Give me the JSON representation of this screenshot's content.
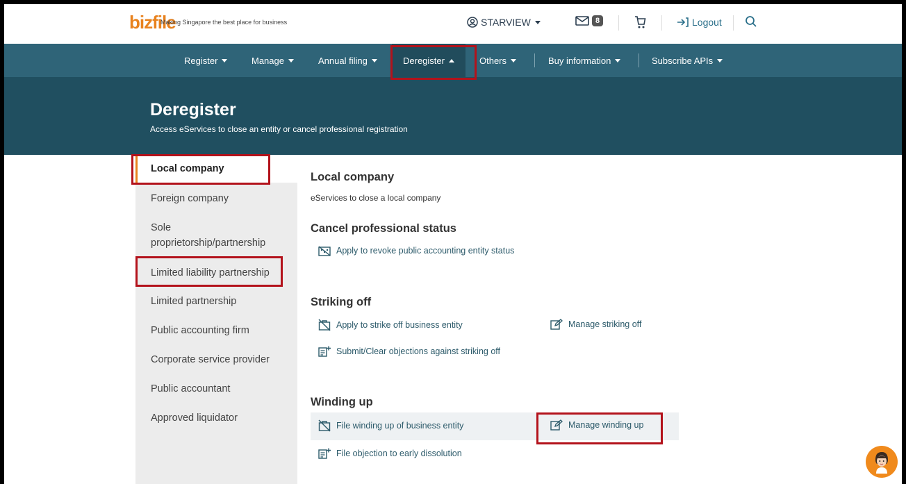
{
  "header": {
    "logo_text": "bizfile",
    "tagline": "Making Singapore the best place for business",
    "user": "STARVIEW",
    "mail_count": "8",
    "logout": "Logout"
  },
  "nav": [
    {
      "label": "Register"
    },
    {
      "label": "Manage"
    },
    {
      "label": "Annual filing"
    },
    {
      "label": "Deregister"
    },
    {
      "label": "Others"
    },
    {
      "label": "Buy information"
    },
    {
      "label": "Subscribe APIs"
    }
  ],
  "banner": {
    "title": "Deregister",
    "subtitle": "Access eServices to close an entity or cancel professional registration"
  },
  "sidebar": {
    "items": [
      {
        "label": "Local company"
      },
      {
        "label": "Foreign company"
      },
      {
        "label": "Sole"
      },
      {
        "label": "proprietorship/partnership"
      },
      {
        "label": "Limited liability partnership"
      },
      {
        "label": "Limited partnership"
      },
      {
        "label": "Public accounting firm"
      },
      {
        "label": "Corporate service provider"
      },
      {
        "label": "Public accountant"
      },
      {
        "label": "Approved liquidator"
      }
    ]
  },
  "main": {
    "title": "Local company",
    "description": "eServices to close a local company",
    "sections": {
      "cancel": {
        "heading": "Cancel professional status",
        "revoke": "Apply to revoke public accounting entity status"
      },
      "striking": {
        "heading": "Striking off",
        "apply": "Apply to strike off business entity",
        "manage": "Manage striking off",
        "objections": "Submit/Clear objections against striking off"
      },
      "winding": {
        "heading": "Winding up",
        "file": "File winding up of business entity",
        "manage": "Manage winding up",
        "objection": "File objection to early dissolution"
      }
    }
  },
  "colors": {
    "nav_bg": "#2f6478",
    "banner_bg": "#204f60",
    "accent": "#e8821e",
    "highlight_box": "#b3121b"
  }
}
